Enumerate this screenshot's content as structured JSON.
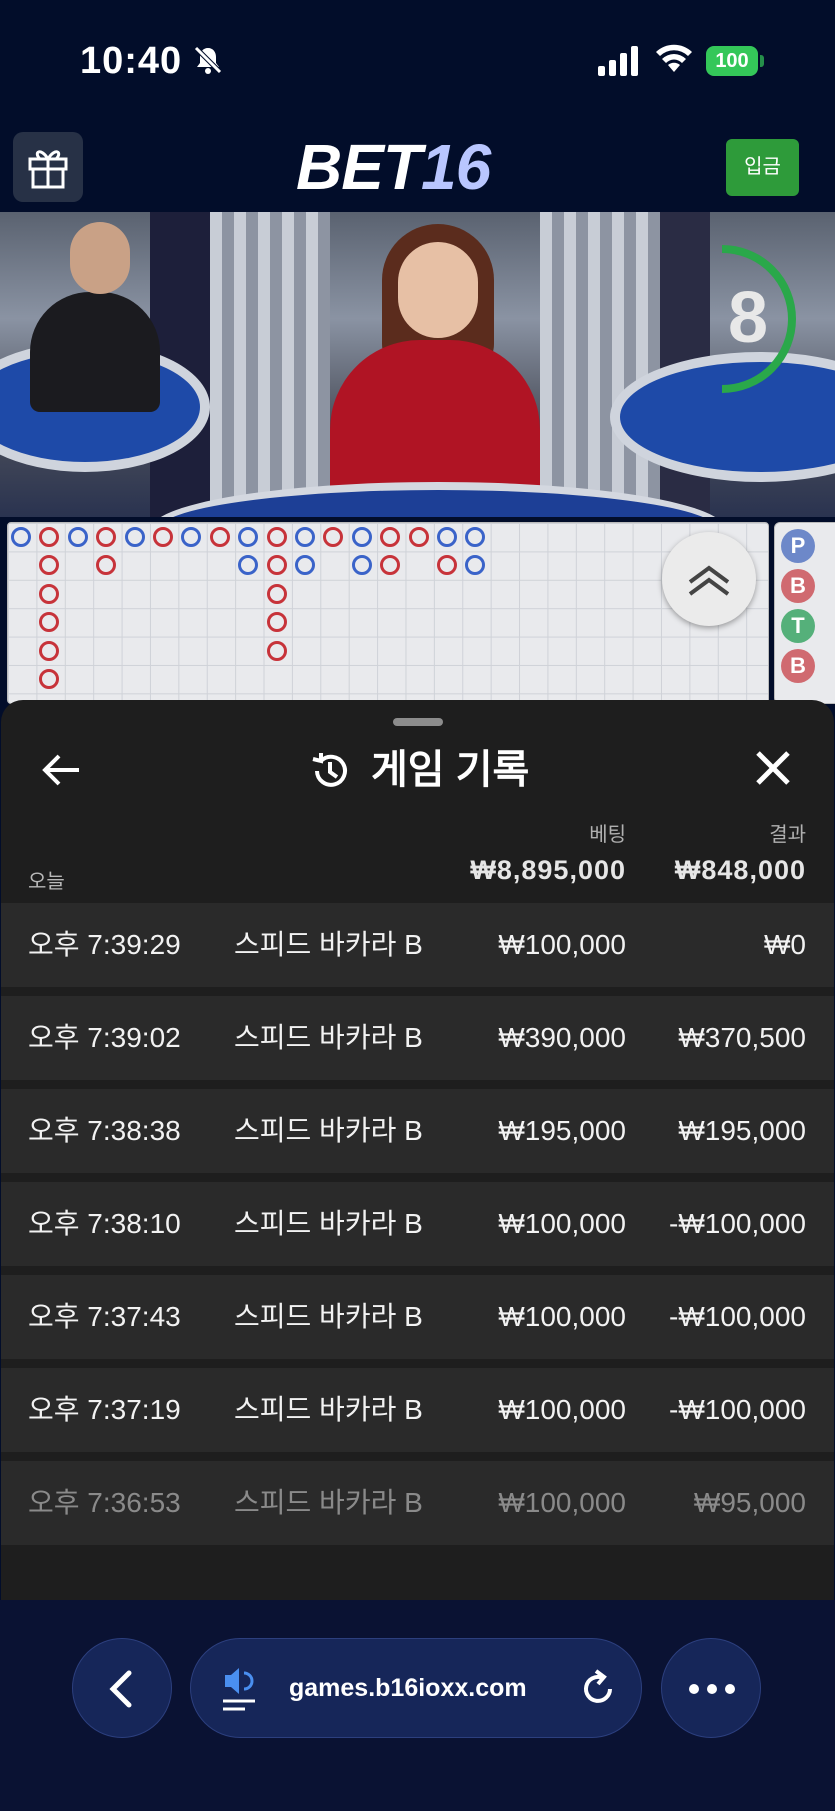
{
  "status_bar": {
    "time": "10:40",
    "battery": "100"
  },
  "header": {
    "logo_main": "BET",
    "logo_num": "16",
    "deposit_label": "입금"
  },
  "video": {
    "countdown": "8"
  },
  "roadmap": {
    "side_labels": [
      "P",
      "B",
      "T",
      "B"
    ]
  },
  "history": {
    "title": "게임 기록",
    "bet_col": "베팅",
    "result_col": "결과",
    "today_label": "오늘",
    "total_bet": "₩8,895,000",
    "total_result": "₩848,000",
    "rows": [
      {
        "time": "오후 7:39:29",
        "game": "스피드 바카라 B",
        "bet": "₩100,000",
        "result": "₩0"
      },
      {
        "time": "오후 7:39:02",
        "game": "스피드 바카라 B",
        "bet": "₩390,000",
        "result": "₩370,500"
      },
      {
        "time": "오후 7:38:38",
        "game": "스피드 바카라 B",
        "bet": "₩195,000",
        "result": "₩195,000"
      },
      {
        "time": "오후 7:38:10",
        "game": "스피드 바카라 B",
        "bet": "₩100,000",
        "result": "-₩100,000"
      },
      {
        "time": "오후 7:37:43",
        "game": "스피드 바카라 B",
        "bet": "₩100,000",
        "result": "-₩100,000"
      },
      {
        "time": "오후 7:37:19",
        "game": "스피드 바카라 B",
        "bet": "₩100,000",
        "result": "-₩100,000"
      },
      {
        "time": "오후 7:36:53",
        "game": "스피드 바카라 B",
        "bet": "₩100,000",
        "result": "₩95,000"
      }
    ]
  },
  "browser": {
    "url": "games.b16ioxx.com"
  }
}
